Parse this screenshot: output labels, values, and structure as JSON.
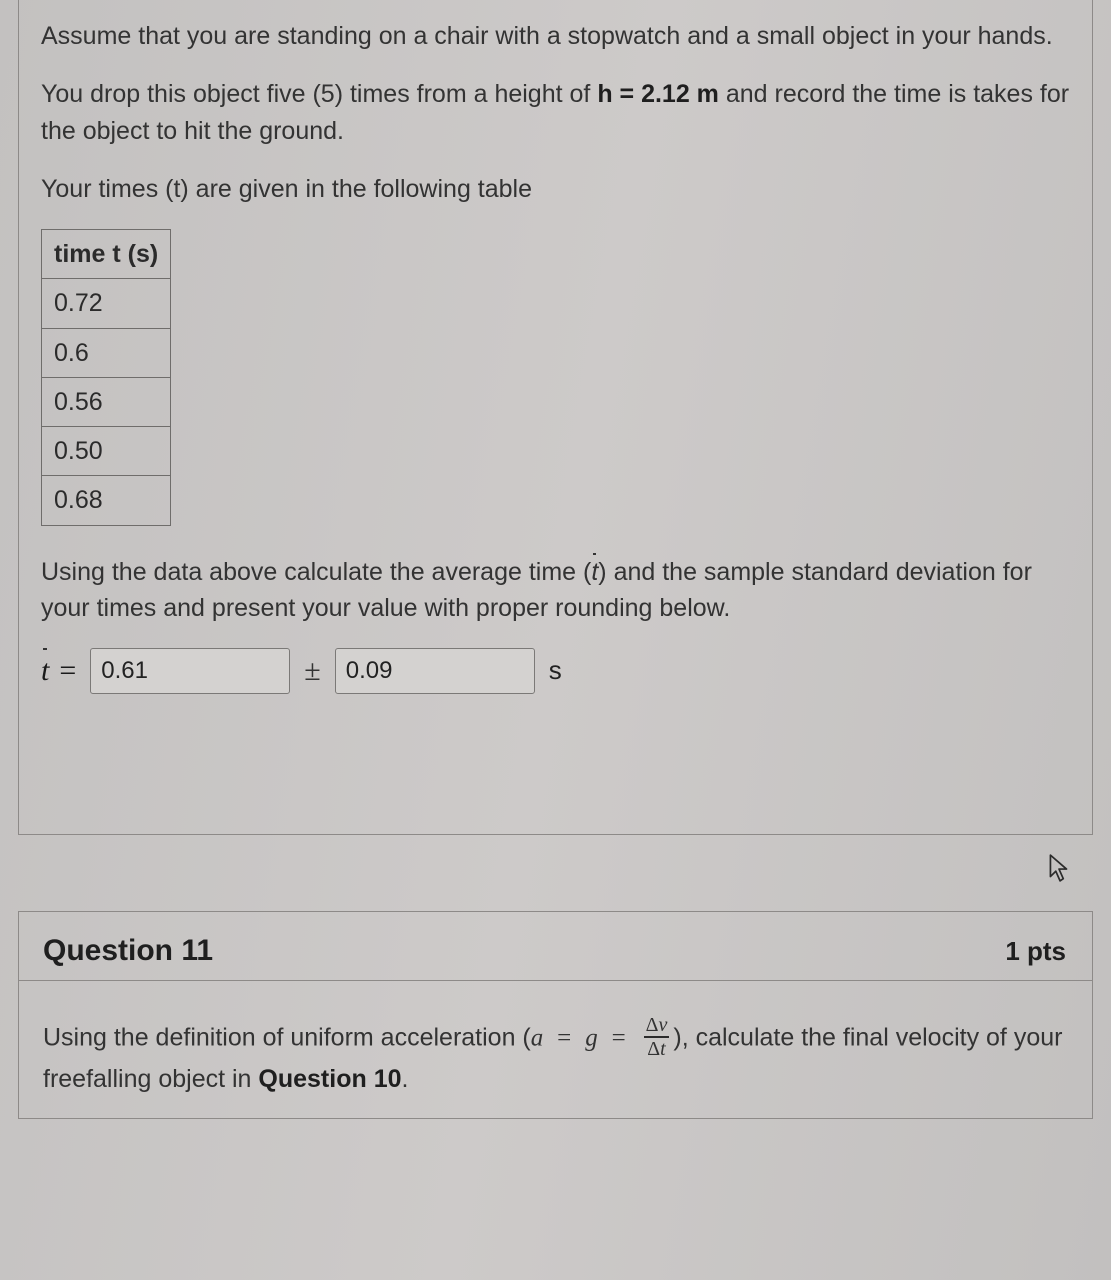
{
  "q10": {
    "para1a": "Assume that you are standing on a chair with a stopwatch and a small object in your hands.",
    "para2a": "You drop this object five (5) times from a height of ",
    "h_label": "h = 2.12 m",
    "para2b": " and record the time is takes for the object to hit the ground.",
    "para3": "Your times (t) are given in the following table",
    "table": {
      "header": "time t (s)",
      "rows": [
        "0.72",
        "0.6",
        "0.56",
        "0.50",
        "0.68"
      ]
    },
    "para4a": "Using the data above calculate the average time (",
    "tbar": "t",
    "para4b": ") and the sample standard deviation for your times and present your value with proper rounding below.",
    "answer": {
      "t_sym": "t",
      "eq": "=",
      "val1": "0.61",
      "pm": "±",
      "val2": "0.09",
      "unit": "s"
    }
  },
  "q11": {
    "title": "Question 11",
    "pts": "1 pts",
    "text_a": "Using the definition of uniform acceleration (",
    "a": "a",
    "eq": "=",
    "g": "g",
    "frac_num": "Δv",
    "frac_den": "Δt",
    "text_b": "), calculate the final velocity of your freefalling object in ",
    "q10ref": "Question 10",
    "period": "."
  }
}
